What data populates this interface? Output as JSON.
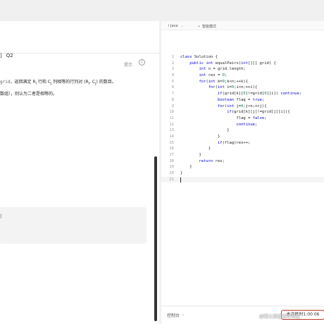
{
  "problem": {
    "hint_label": "提示",
    "info_icon": "info-circle-icon",
    "title_fragment": "]",
    "title_tag": "Q2",
    "desc_code_grid": "grid",
    "desc_text_1": "，返回满足 R",
    "desc_sub_i": "i",
    "desc_text_2": " 行和 C",
    "desc_sub_j": "j",
    "desc_text_3": " 列相等的行列对 (R",
    "desc_text_4": ", C",
    "desc_text_5": ") 的数目。",
    "desc_line_2": "数组），则认为二者是相等的。",
    "example_bracket": "]"
  },
  "editor": {
    "language": "Java",
    "mode_label": "智能模式",
    "code_lines": [
      {
        "n": "1",
        "code": "class Solution {"
      },
      {
        "n": "2",
        "code": "    public int equalPairs(int[][] grid) {"
      },
      {
        "n": "3",
        "code": "        int n = grid.length;"
      },
      {
        "n": "4",
        "code": "        int res = 0;"
      },
      {
        "n": "5",
        "code": "        for(int k=0;k<n;++k){"
      },
      {
        "n": "6",
        "code": "            for(int i=0;i<n;++i){"
      },
      {
        "n": "7",
        "code": "                if(grid[k][0]!=grid[0][i]) continue;"
      },
      {
        "n": "8",
        "code": "                boolean flag = true;"
      },
      {
        "n": "9",
        "code": "                for(int j=0;j<n;++j){"
      },
      {
        "n": "10",
        "code": "                    if(grid[k][j]!=grid[j][i]){"
      },
      {
        "n": "11",
        "code": "                        flag = false;"
      },
      {
        "n": "12",
        "code": "                        continue;"
      },
      {
        "n": "13",
        "code": "                    }"
      },
      {
        "n": "14",
        "code": "                }"
      },
      {
        "n": "15",
        "code": "                if(flag)res++;"
      },
      {
        "n": "16",
        "code": "            }"
      },
      {
        "n": "17",
        "code": "        }"
      },
      {
        "n": "18",
        "code": "        return res;"
      },
      {
        "n": "19",
        "code": "    }"
      },
      {
        "n": "20",
        "code": "}"
      },
      {
        "n": "21",
        "code": ""
      }
    ]
  },
  "console": {
    "label": "控制台",
    "run_label": "本次耗时1:00  06"
  },
  "watermark": "@稀土掘金技术社区",
  "colors": {
    "keyword": "#0000cc",
    "number": "#098658",
    "run_border": "#c0392b"
  }
}
